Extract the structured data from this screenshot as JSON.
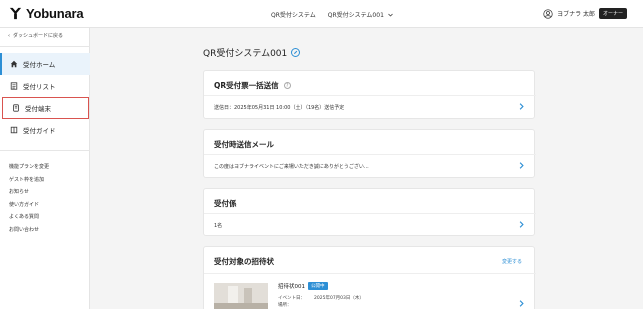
{
  "app": {
    "logo_text": "Yobunara",
    "nav": [
      "QR受付システム",
      "QR受付システム001"
    ],
    "user_name": "ヨブナラ 太郎",
    "role_badge": "オーナー"
  },
  "sidebar": {
    "back_label": "ダッシュボードに戻る",
    "items": [
      {
        "label": "受付ホーム",
        "icon": "home-icon"
      },
      {
        "label": "受付リスト",
        "icon": "list-icon"
      },
      {
        "label": "受付端末",
        "icon": "device-icon"
      },
      {
        "label": "受付ガイド",
        "icon": "book-icon"
      }
    ],
    "links": [
      "機能プランを変更",
      "ゲスト枠を追加",
      "お知らせ",
      "使い方ガイド",
      "よくある質問",
      "お問い合わせ"
    ]
  },
  "main": {
    "title": "QR受付システム001",
    "cards": {
      "bulk_send": {
        "heading": "QR受付票一括送信",
        "body": "送信日：2025年05月31日 10:00（土）（19名）送信予定"
      },
      "reception_mail": {
        "heading": "受付時送信メール",
        "body": "この度はヨブナライベントにご来場いただき誠にありがとうござい..."
      },
      "staff": {
        "heading": "受付係",
        "body": "1名"
      },
      "invitation": {
        "heading": "受付対象の招待状",
        "change_label": "変更する",
        "invite_title": "招待状001",
        "status_badge": "公開中",
        "event_date_label": "イベント日：",
        "event_date_value": "2025年07月03日（木）",
        "place_label": "場所："
      }
    }
  },
  "colors": {
    "accent": "#2d8fd5",
    "highlight": "#d9534f",
    "active_bg": "#eaf3fb"
  }
}
